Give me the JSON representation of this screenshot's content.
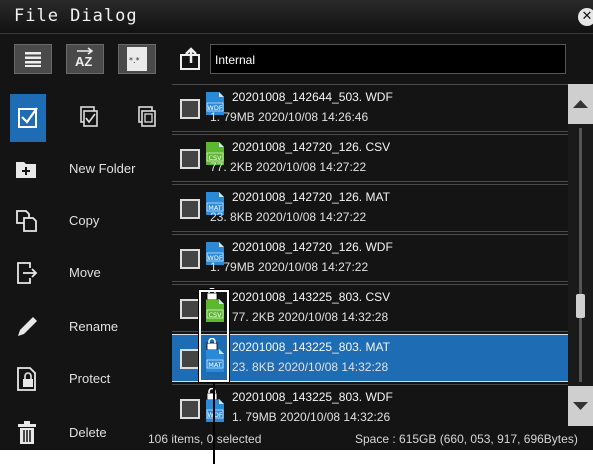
{
  "window": {
    "title": "File Dialog",
    "close_icon": "close-icon"
  },
  "toolbar": {
    "buttons": [
      {
        "name": "list-view-button",
        "icon": "list-icon"
      },
      {
        "name": "sort-az-button",
        "icon": "sort-az-icon",
        "label": "AZ"
      },
      {
        "name": "file-filter-button",
        "icon": "file-filter-icon",
        "label": "*.*"
      }
    ],
    "up_icon": "folder-up-icon",
    "path": "Internal"
  },
  "left_menu": {
    "select_buttons": [
      "select-toggle-icon",
      "select-all-icon",
      "deselect-all-icon"
    ],
    "items": [
      {
        "label": "New Folder",
        "icon": "new-folder-icon"
      },
      {
        "label": "Copy",
        "icon": "copy-icon"
      },
      {
        "label": "Move",
        "icon": "move-icon"
      },
      {
        "label": "Rename",
        "icon": "pencil-icon"
      },
      {
        "label": "Protect",
        "icon": "lock-file-icon"
      },
      {
        "label": "Delete",
        "icon": "trash-icon"
      }
    ]
  },
  "files": [
    {
      "name": "20201008_142644_503. WDF",
      "meta": "1. 79MB   2020/10/08  14:26:46",
      "type": "WDF",
      "protected": false,
      "selected": false
    },
    {
      "name": "20201008_142720_126. CSV",
      "meta": "77. 2KB   2020/10/08  14:27:22",
      "type": "CSV",
      "protected": false,
      "selected": false
    },
    {
      "name": "20201008_142720_126. MAT",
      "meta": "23. 8KB   2020/10/08  14:27:22",
      "type": "MAT",
      "protected": false,
      "selected": false
    },
    {
      "name": "20201008_142720_126. WDF",
      "meta": "1. 79MB   2020/10/08  14:27:22",
      "type": "WDF",
      "protected": false,
      "selected": false
    },
    {
      "name": "20201008_143225_803. CSV",
      "meta": "77. 2KB   2020/10/08  14:32:28",
      "type": "CSV",
      "protected": true,
      "selected": false
    },
    {
      "name": "20201008_143225_803. MAT",
      "meta": "23. 8KB   2020/10/08  14:32:28",
      "type": "MAT",
      "protected": true,
      "selected": true
    },
    {
      "name": "20201008_143225_803. WDF",
      "meta": "1. 79MB   2020/10/08  14:32:26",
      "type": "WDF",
      "protected": true,
      "selected": false
    }
  ],
  "status": {
    "items": "106 items,  0 selected",
    "space": "Space : 615GB (660, 053, 917, 696Bytes)"
  },
  "scrollbar": {
    "position_fraction": 0.72
  },
  "colors": {
    "selected_row": "#1e6cb4",
    "csv_icon": "#5cb82e",
    "wdf_mat_icon": "#2a8ad8",
    "menu_highlight": "#1e6cb4"
  }
}
